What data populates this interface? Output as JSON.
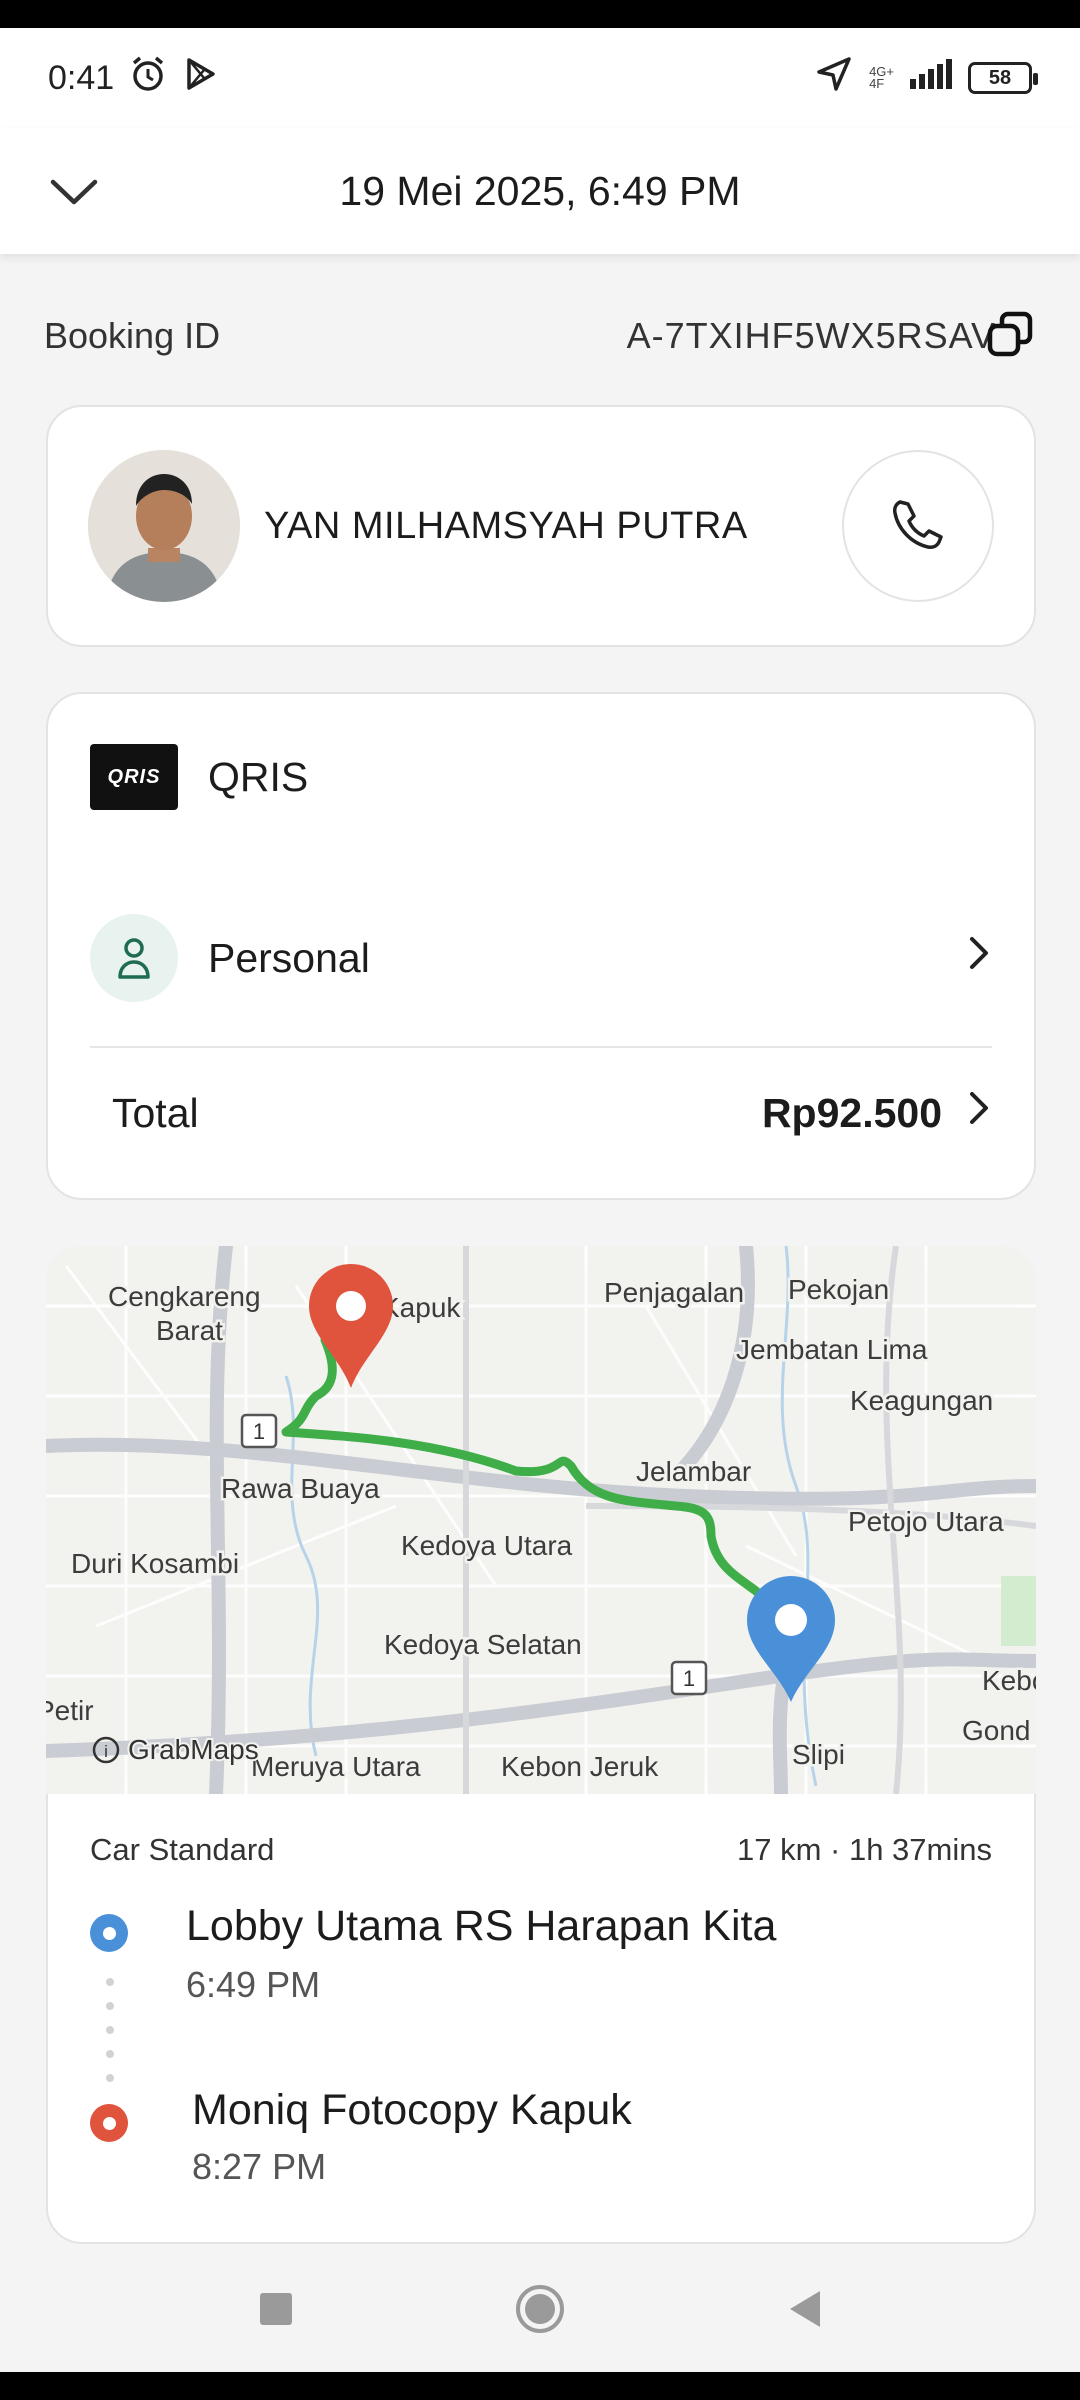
{
  "status_bar": {
    "time": "0:41",
    "network_top": "4G+",
    "network_bottom": "4F",
    "battery": "58"
  },
  "header": {
    "title": "19 Mei 2025, 6:49 PM",
    "back_icon": "chevron-down-icon"
  },
  "booking": {
    "label": "Booking ID",
    "id": "A-7TXIHF5WX5RSAV",
    "copy_icon": "copy-icon"
  },
  "driver": {
    "name": "YAN MILHAMSYAH PUTRA",
    "call_icon": "phone-icon"
  },
  "payment": {
    "method": "QRIS",
    "method_logo_text": "QRIS",
    "profile": "Personal",
    "total_label": "Total",
    "total_amount": "Rp92.500"
  },
  "map": {
    "attribution": "GrabMaps",
    "route_number_1": "1",
    "route_number_2": "1",
    "labels": [
      {
        "text": "Cengkareng"
      },
      {
        "text": "Barat"
      },
      {
        "text": "Kapuk"
      },
      {
        "text": "Penjagalan"
      },
      {
        "text": "Pekojan"
      },
      {
        "text": "Jembatan Lima"
      },
      {
        "text": "Keagungan"
      },
      {
        "text": "Rawa Buaya"
      },
      {
        "text": "Jelambar"
      },
      {
        "text": "Petojo Utara"
      },
      {
        "text": "Duri Kosambi"
      },
      {
        "text": "Kedoya Utara"
      },
      {
        "text": "Kedoya Selatan"
      },
      {
        "text": "Petir"
      },
      {
        "text": "Meruya Utara"
      },
      {
        "text": "Kebon Jeruk"
      },
      {
        "text": "Slipi"
      },
      {
        "text": "Kebo"
      },
      {
        "text": "Gond"
      }
    ],
    "colors": {
      "route": "#4caf50",
      "pickup": "#4a90d9",
      "dropoff": "#e0533d"
    }
  },
  "trip": {
    "vehicle": "Car Standard",
    "distance_duration": "17 km · 1h 37mins",
    "pickup": {
      "place": "Lobby Utama RS Harapan Kita",
      "time": "6:49 PM"
    },
    "dropoff": {
      "place": "Moniq Fotocopy Kapuk",
      "time": "8:27 PM"
    }
  },
  "nav": {
    "recents_icon": "square-icon",
    "home_icon": "circle-icon",
    "back_icon": "triangle-back-icon"
  }
}
